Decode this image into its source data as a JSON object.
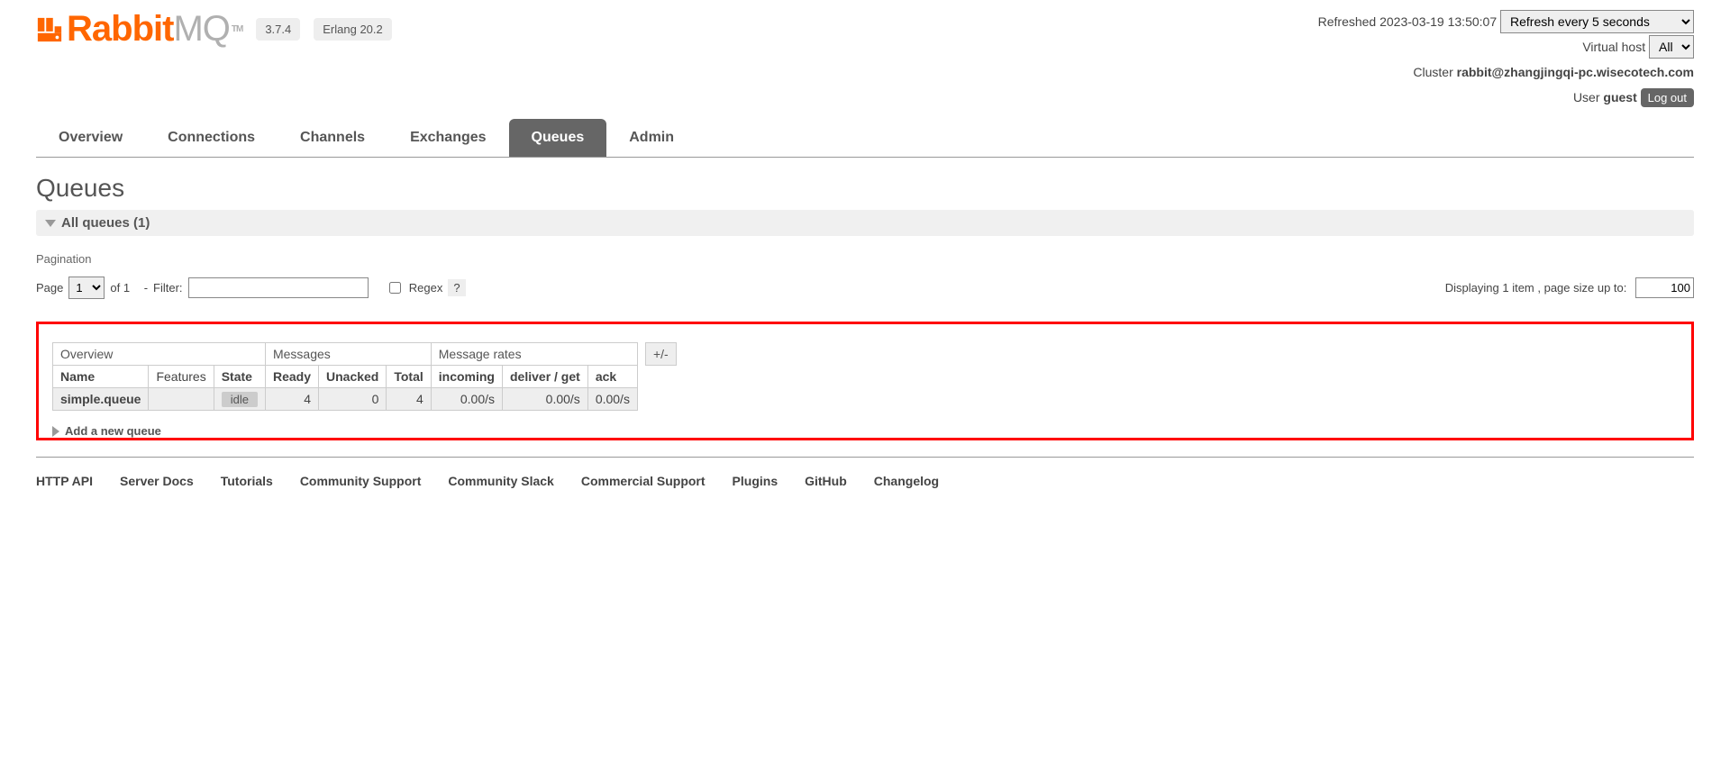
{
  "header": {
    "logo_rabbit": "Rabbit",
    "logo_mq": "MQ",
    "logo_tm": "TM",
    "version_badge": "3.7.4",
    "erlang_badge": "Erlang 20.2"
  },
  "status": {
    "refreshed_label": "Refreshed 2023-03-19 13:50:07",
    "refresh_option": "Refresh every 5 seconds",
    "vhost_label": "Virtual host",
    "vhost_option": "All",
    "cluster_label": "Cluster ",
    "cluster_value": "rabbit@zhangjingqi-pc.wisecotech.com",
    "user_label": "User ",
    "user_value": "guest",
    "logout_label": "Log out"
  },
  "nav": {
    "overview": "Overview",
    "connections": "Connections",
    "channels": "Channels",
    "exchanges": "Exchanges",
    "queues": "Queues",
    "admin": "Admin"
  },
  "page": {
    "title": "Queues",
    "section_header": "All queues (1)",
    "pagination_label": "Pagination",
    "page_label": "Page",
    "page_select": "1",
    "of_label": "of 1",
    "filter_dash": "-",
    "filter_label": "Filter:",
    "regex_label": "Regex",
    "regex_help": "?",
    "displaying_label": "Displaying 1 item , page size up to:",
    "page_size": "100",
    "plusminus": "+/-",
    "addnew": "Add a new queue"
  },
  "table": {
    "group_overview": "Overview",
    "group_messages": "Messages",
    "group_rates": "Message rates",
    "col_name": "Name",
    "col_features": "Features",
    "col_state": "State",
    "col_ready": "Ready",
    "col_unacked": "Unacked",
    "col_total": "Total",
    "col_incoming": "incoming",
    "col_deliver": "deliver / get",
    "col_ack": "ack",
    "rows": [
      {
        "name": "simple.queue",
        "features": "",
        "state": "idle",
        "ready": "4",
        "unacked": "0",
        "total": "4",
        "incoming": "0.00/s",
        "deliver": "0.00/s",
        "ack": "0.00/s"
      }
    ]
  },
  "footer": {
    "http_api": "HTTP API",
    "server_docs": "Server Docs",
    "tutorials": "Tutorials",
    "community_support": "Community Support",
    "community_slack": "Community Slack",
    "commercial_support": "Commercial Support",
    "plugins": "Plugins",
    "github": "GitHub",
    "changelog": "Changelog"
  }
}
